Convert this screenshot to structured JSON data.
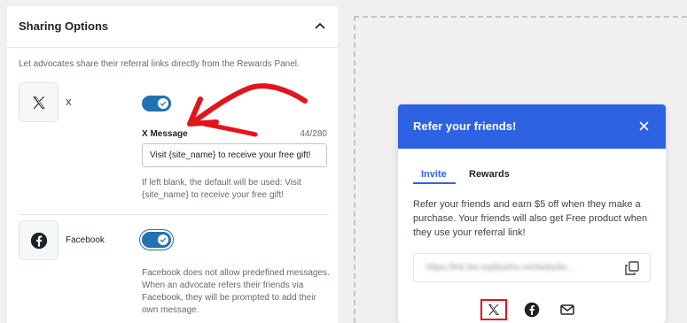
{
  "settings": {
    "title": "Sharing Options",
    "help_text": "Let advocates share their referral links directly from the Rewards Panel.",
    "x": {
      "label": "X",
      "enabled": true,
      "message_label": "X Message",
      "char_count": "44/280",
      "message_value": "Visit {site_name} to receive your free gift!",
      "help": "If left blank, the default will be used: Visit {site_name} to receive your free gift!"
    },
    "facebook": {
      "label": "Facebook",
      "enabled": true,
      "help": "Facebook does not allow predefined messages. When an advocate refers their friends via Facebook, they will be prompted to add their own message."
    }
  },
  "widget": {
    "title": "Refer your friends!",
    "tabs": [
      {
        "label": "Invite",
        "active": true
      },
      {
        "label": "Rewards",
        "active": false
      }
    ],
    "body": "Refer your friends and earn $5 off when they make a purchase. Your friends will also get Free product when they use your referral link!",
    "link": "https://lnk.bio.myblueho.me/website...",
    "share_icons": [
      "x-icon",
      "facebook-icon",
      "mail-icon"
    ]
  },
  "colors": {
    "accent": "#2271b1",
    "widget_header": "#2d63e3",
    "annotation": "#e3141b"
  }
}
